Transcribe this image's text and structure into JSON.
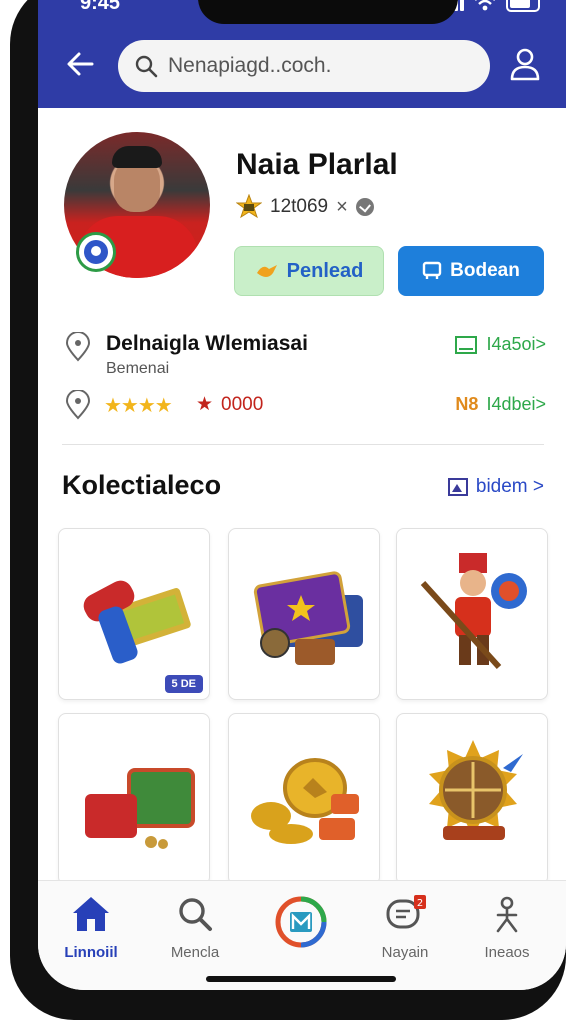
{
  "status_bar": {
    "time": "9:45"
  },
  "search": {
    "placeholder": "Nenapiagd..coch."
  },
  "profile": {
    "name": "Naia Plarlal",
    "rank_value": "12t069",
    "rank_close": "×",
    "follow_label": "Penlead",
    "message_label": "Bodean"
  },
  "info": {
    "location_title": "Delnaigla Wlemiasai",
    "location_sub": "Bemenai",
    "location_stat": "I4a5oi>",
    "stars": "★★★★",
    "points": "0000",
    "rating_stat": "I4dbei>",
    "rating_stat_prefix": "N8"
  },
  "collection": {
    "title": "Kolectialeco",
    "see_all": "bidem >",
    "items": [
      {
        "icon": "rolled-scroll-icon",
        "badge": "5 DE"
      },
      {
        "icon": "card-deck-icon"
      },
      {
        "icon": "warrior-figure-icon"
      },
      {
        "icon": "gift-box-icon"
      },
      {
        "icon": "gold-coins-icon"
      },
      {
        "icon": "shield-emblem-icon"
      }
    ]
  },
  "bottom_nav": [
    {
      "label": "Linnoiil",
      "icon": "home-icon",
      "active": true
    },
    {
      "label": "Mencla",
      "icon": "search-icon",
      "active": false
    },
    {
      "label": "",
      "icon": "center-app-icon",
      "active": false
    },
    {
      "label": "Nayain",
      "icon": "chat-icon",
      "active": false,
      "badge": "2"
    },
    {
      "label": "Ineaos",
      "icon": "figure-icon",
      "active": false
    }
  ],
  "colors": {
    "header": "#2f3ca6",
    "follow_bg": "#c9efc9",
    "message_bg": "#1e7fdb",
    "accent_blue": "#2740b8",
    "stat_green": "#2ea84a",
    "stat_orange": "#e08a1c"
  }
}
